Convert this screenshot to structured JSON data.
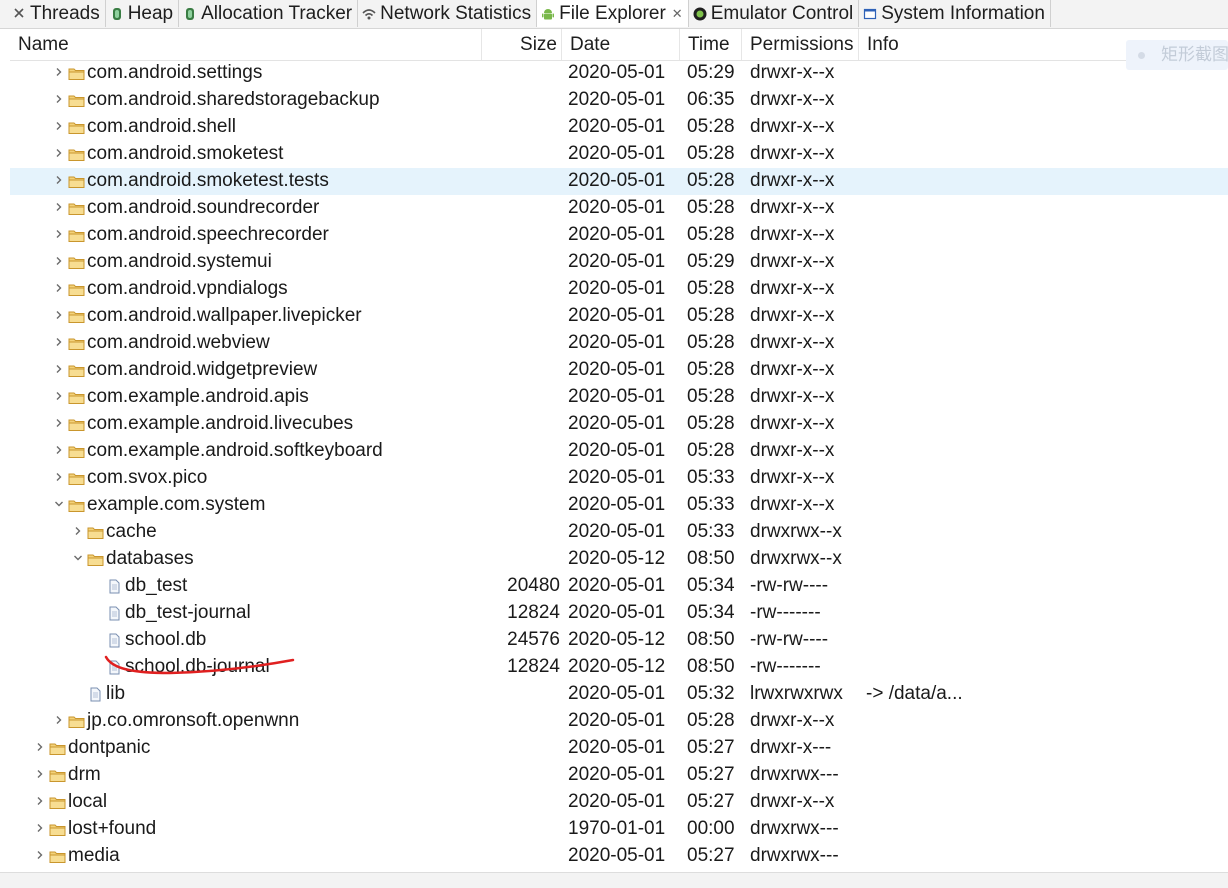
{
  "tabs": [
    {
      "label": "Threads",
      "icon": "threads-icon"
    },
    {
      "label": "Heap",
      "icon": "heap-icon"
    },
    {
      "label": "Allocation Tracker",
      "icon": "allocation-icon"
    },
    {
      "label": "Network Statistics",
      "icon": "network-icon"
    },
    {
      "label": "File Explorer",
      "icon": "android-icon",
      "active": true,
      "close": "✕"
    },
    {
      "label": "Emulator Control",
      "icon": "emulator-icon"
    },
    {
      "label": "System Information",
      "icon": "system-info-icon"
    }
  ],
  "columns": {
    "name": "Name",
    "size": "Size",
    "date": "Date",
    "time": "Time",
    "permissions": "Permissions",
    "info": "Info"
  },
  "ghost_text": "矩形截图",
  "rows": [
    {
      "name": "com.android.settings",
      "depth": 2,
      "type": "folder",
      "expand": "collapsed",
      "size": "",
      "date": "2020-05-01",
      "time": "05:29",
      "perm": "drwxr-x--x",
      "info": ""
    },
    {
      "name": "com.android.sharedstoragebackup",
      "depth": 2,
      "type": "folder",
      "expand": "collapsed",
      "size": "",
      "date": "2020-05-01",
      "time": "06:35",
      "perm": "drwxr-x--x",
      "info": ""
    },
    {
      "name": "com.android.shell",
      "depth": 2,
      "type": "folder",
      "expand": "collapsed",
      "size": "",
      "date": "2020-05-01",
      "time": "05:28",
      "perm": "drwxr-x--x",
      "info": ""
    },
    {
      "name": "com.android.smoketest",
      "depth": 2,
      "type": "folder",
      "expand": "collapsed",
      "size": "",
      "date": "2020-05-01",
      "time": "05:28",
      "perm": "drwxr-x--x",
      "info": ""
    },
    {
      "name": "com.android.smoketest.tests",
      "depth": 2,
      "type": "folder",
      "expand": "collapsed",
      "size": "",
      "date": "2020-05-01",
      "time": "05:28",
      "perm": "drwxr-x--x",
      "info": "",
      "selected": true
    },
    {
      "name": "com.android.soundrecorder",
      "depth": 2,
      "type": "folder",
      "expand": "collapsed",
      "size": "",
      "date": "2020-05-01",
      "time": "05:28",
      "perm": "drwxr-x--x",
      "info": ""
    },
    {
      "name": "com.android.speechrecorder",
      "depth": 2,
      "type": "folder",
      "expand": "collapsed",
      "size": "",
      "date": "2020-05-01",
      "time": "05:28",
      "perm": "drwxr-x--x",
      "info": ""
    },
    {
      "name": "com.android.systemui",
      "depth": 2,
      "type": "folder",
      "expand": "collapsed",
      "size": "",
      "date": "2020-05-01",
      "time": "05:29",
      "perm": "drwxr-x--x",
      "info": ""
    },
    {
      "name": "com.android.vpndialogs",
      "depth": 2,
      "type": "folder",
      "expand": "collapsed",
      "size": "",
      "date": "2020-05-01",
      "time": "05:28",
      "perm": "drwxr-x--x",
      "info": ""
    },
    {
      "name": "com.android.wallpaper.livepicker",
      "depth": 2,
      "type": "folder",
      "expand": "collapsed",
      "size": "",
      "date": "2020-05-01",
      "time": "05:28",
      "perm": "drwxr-x--x",
      "info": ""
    },
    {
      "name": "com.android.webview",
      "depth": 2,
      "type": "folder",
      "expand": "collapsed",
      "size": "",
      "date": "2020-05-01",
      "time": "05:28",
      "perm": "drwxr-x--x",
      "info": ""
    },
    {
      "name": "com.android.widgetpreview",
      "depth": 2,
      "type": "folder",
      "expand": "collapsed",
      "size": "",
      "date": "2020-05-01",
      "time": "05:28",
      "perm": "drwxr-x--x",
      "info": ""
    },
    {
      "name": "com.example.android.apis",
      "depth": 2,
      "type": "folder",
      "expand": "collapsed",
      "size": "",
      "date": "2020-05-01",
      "time": "05:28",
      "perm": "drwxr-x--x",
      "info": ""
    },
    {
      "name": "com.example.android.livecubes",
      "depth": 2,
      "type": "folder",
      "expand": "collapsed",
      "size": "",
      "date": "2020-05-01",
      "time": "05:28",
      "perm": "drwxr-x--x",
      "info": ""
    },
    {
      "name": "com.example.android.softkeyboard",
      "depth": 2,
      "type": "folder",
      "expand": "collapsed",
      "size": "",
      "date": "2020-05-01",
      "time": "05:28",
      "perm": "drwxr-x--x",
      "info": ""
    },
    {
      "name": "com.svox.pico",
      "depth": 2,
      "type": "folder",
      "expand": "collapsed",
      "size": "",
      "date": "2020-05-01",
      "time": "05:33",
      "perm": "drwxr-x--x",
      "info": ""
    },
    {
      "name": "example.com.system",
      "depth": 2,
      "type": "folder",
      "expand": "expanded",
      "size": "",
      "date": "2020-05-01",
      "time": "05:33",
      "perm": "drwxr-x--x",
      "info": ""
    },
    {
      "name": "cache",
      "depth": 3,
      "type": "folder",
      "expand": "collapsed",
      "size": "",
      "date": "2020-05-01",
      "time": "05:33",
      "perm": "drwxrwx--x",
      "info": ""
    },
    {
      "name": "databases",
      "depth": 3,
      "type": "folder",
      "expand": "expanded",
      "size": "",
      "date": "2020-05-12",
      "time": "08:50",
      "perm": "drwxrwx--x",
      "info": ""
    },
    {
      "name": "db_test",
      "depth": 4,
      "type": "file",
      "expand": "none",
      "size": "20480",
      "date": "2020-05-01",
      "time": "05:34",
      "perm": "-rw-rw----",
      "info": ""
    },
    {
      "name": "db_test-journal",
      "depth": 4,
      "type": "file",
      "expand": "none",
      "size": "12824",
      "date": "2020-05-01",
      "time": "05:34",
      "perm": "-rw-------",
      "info": ""
    },
    {
      "name": "school.db",
      "depth": 4,
      "type": "file",
      "expand": "none",
      "size": "24576",
      "date": "2020-05-12",
      "time": "08:50",
      "perm": "-rw-rw----",
      "info": ""
    },
    {
      "name": "school.db-journal",
      "depth": 4,
      "type": "file",
      "expand": "none",
      "size": "12824",
      "date": "2020-05-12",
      "time": "08:50",
      "perm": "-rw-------",
      "info": ""
    },
    {
      "name": "lib",
      "depth": 3,
      "type": "file",
      "expand": "none",
      "size": "",
      "date": "2020-05-01",
      "time": "05:32",
      "perm": "lrwxrwxrwx",
      "info": "-> /data/a..."
    },
    {
      "name": "jp.co.omronsoft.openwnn",
      "depth": 2,
      "type": "folder",
      "expand": "collapsed",
      "size": "",
      "date": "2020-05-01",
      "time": "05:28",
      "perm": "drwxr-x--x",
      "info": ""
    },
    {
      "name": "dontpanic",
      "depth": 1,
      "type": "folder",
      "expand": "collapsed",
      "size": "",
      "date": "2020-05-01",
      "time": "05:27",
      "perm": "drwxr-x---",
      "info": ""
    },
    {
      "name": "drm",
      "depth": 1,
      "type": "folder",
      "expand": "collapsed",
      "size": "",
      "date": "2020-05-01",
      "time": "05:27",
      "perm": "drwxrwx---",
      "info": ""
    },
    {
      "name": "local",
      "depth": 1,
      "type": "folder",
      "expand": "collapsed",
      "size": "",
      "date": "2020-05-01",
      "time": "05:27",
      "perm": "drwxr-x--x",
      "info": ""
    },
    {
      "name": "lost+found",
      "depth": 1,
      "type": "folder",
      "expand": "collapsed",
      "size": "",
      "date": "1970-01-01",
      "time": "00:00",
      "perm": "drwxrwx---",
      "info": ""
    },
    {
      "name": "media",
      "depth": 1,
      "type": "folder",
      "expand": "collapsed",
      "size": "",
      "date": "2020-05-01",
      "time": "05:27",
      "perm": "drwxrwx---",
      "info": ""
    }
  ],
  "colors": {
    "selected_row": "#e5f3fc",
    "folder": "#e8b64c",
    "annotation": "#e02020"
  }
}
